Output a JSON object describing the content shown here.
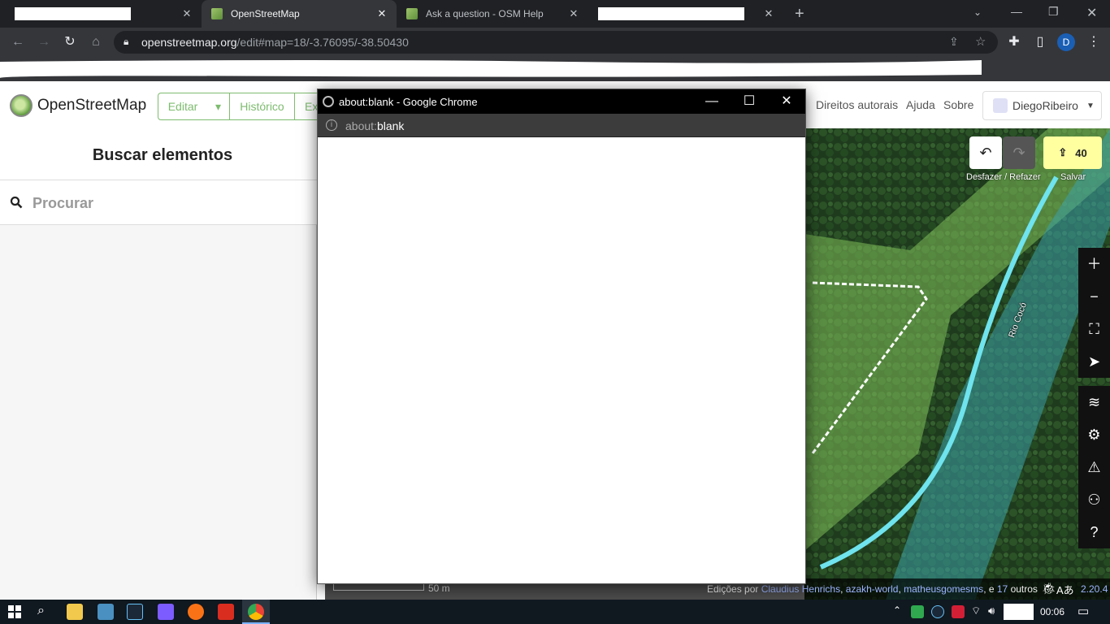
{
  "browser": {
    "tabs": [
      {
        "title": "",
        "redacted": true,
        "active": false
      },
      {
        "title": "OpenStreetMap",
        "active": true
      },
      {
        "title": "Ask a question - OSM Help",
        "active": false
      },
      {
        "title": "",
        "redacted": true,
        "active": false
      }
    ],
    "new_tab": "+",
    "url_host": "openstreetmap.org",
    "url_path": "/edit#map=18/-3.76095/-38.50430",
    "profile_initial": "D"
  },
  "osm": {
    "logo_text": "OpenStreetMap",
    "edit_label": "Editar",
    "history_label": "Histórico",
    "export_label": "Ex",
    "links": [
      "Direitos autorais",
      "Ajuda",
      "Sobre"
    ],
    "user": "DiegoRibeiro",
    "sidebar_title": "Buscar elementos",
    "search_placeholder": "Procurar",
    "undo_redo_label": "Desfazer / Refazer",
    "save_label": "Salvar",
    "save_count": "40",
    "map_label_river": "Rio Cocó",
    "scale_label": "50 m",
    "footer": {
      "prefix": "Edições por ",
      "users": [
        "Claudius Henrichs",
        "azakh-world",
        "matheusgomesms"
      ],
      "and": ", e ",
      "others_count": "17",
      "others": " outros",
      "version": "2.20.4"
    }
  },
  "popup": {
    "title": "about:blank - Google Chrome",
    "url_prefix": "about:",
    "url_main": "blank"
  },
  "taskbar": {
    "time": "00:06"
  },
  "colors": {
    "osm_green": "#7ebc6f",
    "save_yellow": "#ffffa0",
    "river": "#6fe3ee"
  }
}
